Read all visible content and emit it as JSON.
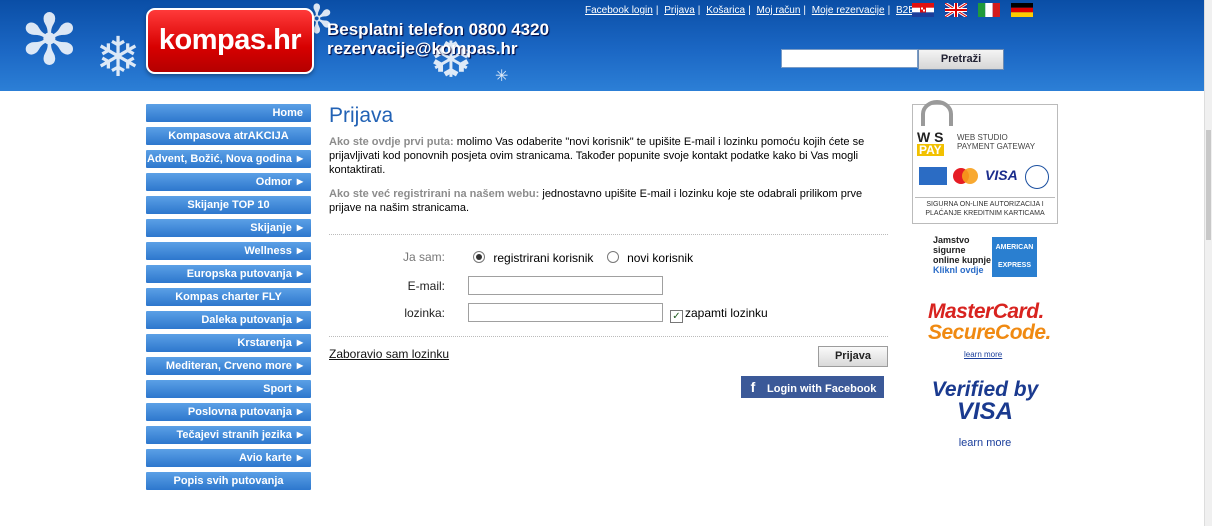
{
  "header": {
    "logo_text": "kompas.hr",
    "contact_line1": "Besplatni telefon 0800 4320",
    "contact_line2": "rezervacije@kompas.hr",
    "links": [
      "Facebook login",
      "Prijava",
      "Košarica",
      "Moj račun",
      "Moje rezervacije",
      "B2B"
    ],
    "search_placeholder": "",
    "search_button": "Pretraži",
    "flags": [
      "hr-flag",
      "uk-flag",
      "it-flag",
      "de-flag"
    ]
  },
  "sidebar": {
    "items": [
      {
        "label": "Home",
        "arrow": false
      },
      {
        "label": "Kompasova atrAKCIJA",
        "arrow": false
      },
      {
        "label": "Advent, Božić, Nova godina",
        "arrow": true
      },
      {
        "label": "Odmor",
        "arrow": true
      },
      {
        "label": "Skijanje TOP 10",
        "arrow": false
      },
      {
        "label": "Skijanje",
        "arrow": true
      },
      {
        "label": "Wellness",
        "arrow": true
      },
      {
        "label": "Europska putovanja",
        "arrow": true
      },
      {
        "label": "Kompas charter FLY",
        "arrow": false
      },
      {
        "label": "Daleka putovanja",
        "arrow": true
      },
      {
        "label": "Krstarenja",
        "arrow": true
      },
      {
        "label": "Mediteran, Crveno more",
        "arrow": true
      },
      {
        "label": "Sport",
        "arrow": true
      },
      {
        "label": "Poslovna putovanja",
        "arrow": true
      },
      {
        "label": "Tečajevi stranih jezika",
        "arrow": true
      },
      {
        "label": "Avio karte",
        "arrow": true
      },
      {
        "label": "Popis svih putovanja",
        "arrow": false
      }
    ]
  },
  "main": {
    "title": "Prijava",
    "para1_lead": "Ako ste ovdje prvi puta:",
    "para1_text": " molimo Vas odaberite \"novi korisnik\" te upišite E-mail i lozinku pomoću kojih ćete se prijavljivati kod ponovnih posjeta ovim stranicama. Također popunite svoje kontakt podatke kako bi Vas mogli kontaktirati.",
    "para2_lead": "Ako ste već registrirani na našem webu:",
    "para2_text": " jednostavno upišite E-mail i lozinku koje ste odabrali prilikom prve prijave na našim stranicama.",
    "form": {
      "ja_sam_label": "Ja sam:",
      "radio_registered": "registrirani korisnik",
      "radio_new": "novi korisnik",
      "selected": "registrirani korisnik",
      "email_label": "E-mail:",
      "email_value": "",
      "password_label": "lozinka:",
      "password_value": "",
      "remember_label": "zapamti lozinku",
      "remember_checked": true,
      "forgot_link": "Zaboravio sam lozinku",
      "submit_button": "Prijava",
      "facebook_button": "Login with Facebook"
    }
  },
  "right": {
    "wspay_title_line1": "WEB STUDIO",
    "wspay_title_line2": "PAYMENT GATEWAY",
    "wspay_footer": "SIGURNA ON-LINE AUTORIZACIJA I PLAĆANJE KREDITNIM KARTICAMA",
    "amex_text1": "Jamstvo",
    "amex_text2": "sigurne",
    "amex_text3": "online kupnje",
    "amex_text4": "Kliknl ovdje",
    "amex_logo": "AMERICAN EXPRESS",
    "mc_line1": "MasterCard.",
    "mc_line2": "SecureCode.",
    "mc_learn": "learn more",
    "visa_line1": "Verified by",
    "visa_line2": "VISA",
    "visa_learn": "learn more"
  }
}
